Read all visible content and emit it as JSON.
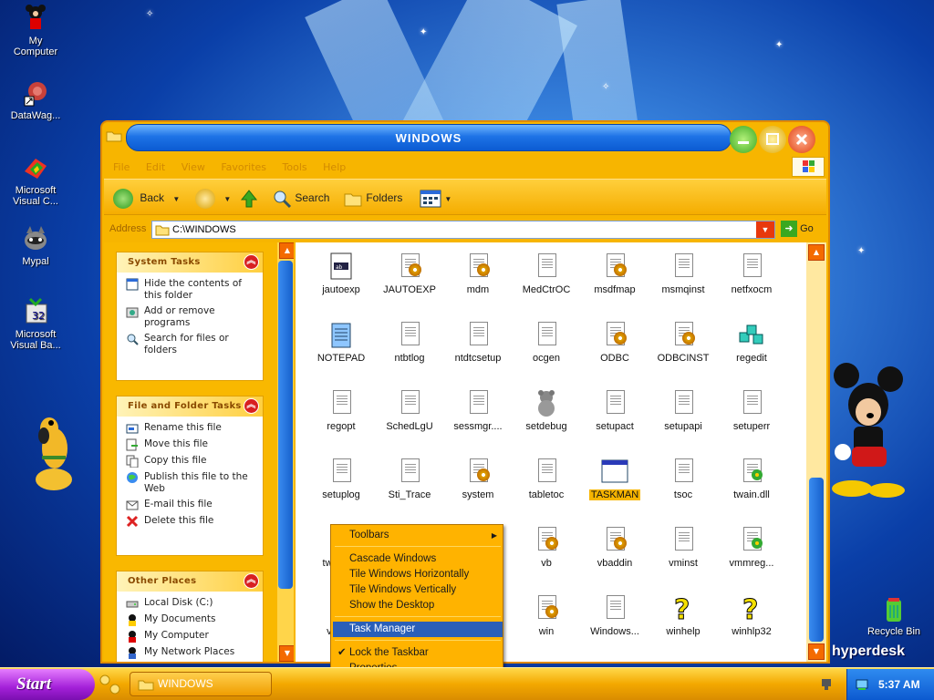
{
  "desktop": {
    "icons": [
      {
        "label": "My\nComputer",
        "icon": "my-computer-icon"
      },
      {
        "label": "DataWag...",
        "icon": "shortcut-icon"
      },
      {
        "label": "Microsoft\nVisual C...",
        "icon": "visual-c-icon"
      },
      {
        "label": "Mypal",
        "icon": "mypal-icon"
      },
      {
        "label": "Microsoft\nVisual Ba...",
        "icon": "visual-basic-icon"
      },
      {
        "label": "Recycle Bin",
        "icon": "recycle-bin-icon"
      }
    ],
    "brand": "hyperdesk"
  },
  "window": {
    "title": "WINDOWS",
    "menu": [
      "File",
      "Edit",
      "View",
      "Favorites",
      "Tools",
      "Help"
    ],
    "toolbar": {
      "back": "Back",
      "search": "Search",
      "folders": "Folders"
    },
    "address": {
      "label": "Address",
      "value": "C:\\WINDOWS",
      "go": "Go"
    }
  },
  "taskpane": {
    "system": {
      "title": "System Tasks",
      "items": [
        "Hide the contents of this folder",
        "Add or remove programs",
        "Search for files or folders"
      ]
    },
    "filefolder": {
      "title": "File and Folder Tasks",
      "items": [
        "Rename this file",
        "Move this file",
        "Copy this file",
        "Publish this file to the Web",
        "E-mail this file",
        "Delete this file"
      ]
    },
    "other": {
      "title": "Other Places",
      "items": [
        "Local Disk (C:)",
        "My Documents",
        "My Computer",
        "My Network Places"
      ]
    }
  },
  "files": [
    {
      "label": "jautoexp",
      "icon": "ini-icon"
    },
    {
      "label": "JAUTOEXP",
      "icon": "config-icon"
    },
    {
      "label": "mdm",
      "icon": "config-icon"
    },
    {
      "label": "MedCtrOC",
      "icon": "text-file-icon"
    },
    {
      "label": "msdfmap",
      "icon": "config-icon"
    },
    {
      "label": "msmqinst",
      "icon": "text-file-icon"
    },
    {
      "label": "netfxocm",
      "icon": "text-file-icon"
    },
    {
      "label": "NOTEPAD",
      "icon": "notepad-icon"
    },
    {
      "label": "ntbtlog",
      "icon": "text-file-icon"
    },
    {
      "label": "ntdtcsetup",
      "icon": "text-file-icon"
    },
    {
      "label": "ocgen",
      "icon": "text-file-icon"
    },
    {
      "label": "ODBC",
      "icon": "config-icon"
    },
    {
      "label": "ODBCINST",
      "icon": "config-icon"
    },
    {
      "label": "regedit",
      "icon": "regedit-icon"
    },
    {
      "label": "regopt",
      "icon": "text-file-icon"
    },
    {
      "label": "SchedLgU",
      "icon": "text-file-icon"
    },
    {
      "label": "sessmgr....",
      "icon": "text-file-icon"
    },
    {
      "label": "setdebug",
      "icon": "bear-icon"
    },
    {
      "label": "setupact",
      "icon": "text-file-icon"
    },
    {
      "label": "setupapi",
      "icon": "text-file-icon"
    },
    {
      "label": "setuperr",
      "icon": "text-file-icon"
    },
    {
      "label": "setuplog",
      "icon": "text-file-icon"
    },
    {
      "label": "Sti_Trace",
      "icon": "text-file-icon"
    },
    {
      "label": "system",
      "icon": "config-icon"
    },
    {
      "label": "tabletoc",
      "icon": "text-file-icon"
    },
    {
      "label": "TASKMAN",
      "icon": "application-icon"
    },
    {
      "label": "tsoc",
      "icon": "text-file-icon"
    },
    {
      "label": "twain.dll",
      "icon": "dll-icon"
    },
    {
      "label": "twain_...",
      "icon": "config-icon"
    },
    {
      "label": "",
      "icon": "text-file-icon"
    },
    {
      "label": "",
      "icon": "text-file-icon"
    },
    {
      "label": "vb",
      "icon": "config-icon"
    },
    {
      "label": "vbaddin",
      "icon": "config-icon"
    },
    {
      "label": "vminst",
      "icon": "text-file-icon"
    },
    {
      "label": "vmmreg...",
      "icon": "dll-icon"
    },
    {
      "label": "vsse...",
      "icon": "text-file-icon"
    },
    {
      "label": "",
      "icon": "text-file-icon"
    },
    {
      "label": "",
      "icon": "text-file-icon"
    },
    {
      "label": "win",
      "icon": "config-icon"
    },
    {
      "label": "Windows...",
      "icon": "text-file-icon"
    },
    {
      "label": "winhelp",
      "icon": "help-icon"
    },
    {
      "label": "winhlp32",
      "icon": "help-icon"
    }
  ],
  "context_menu": {
    "items": [
      {
        "label": "Toolbars",
        "has_submenu": true
      },
      {
        "label": "Cascade Windows"
      },
      {
        "label": "Tile Windows Horizontally"
      },
      {
        "label": "Tile Windows Vertically"
      },
      {
        "label": "Show the Desktop"
      },
      {
        "label": "Task Manager",
        "highlighted": true
      },
      {
        "label": "Lock the Taskbar",
        "checked": true
      },
      {
        "label": "Properties"
      }
    ]
  },
  "taskbar": {
    "start": "Start",
    "window_button": "WINDOWS",
    "clock": "5:37 AM"
  },
  "colors": {
    "accent": "#f7b500",
    "titlebar": "#1e73e6",
    "start": "#a320d8",
    "highlight": "#2a5fb8"
  }
}
